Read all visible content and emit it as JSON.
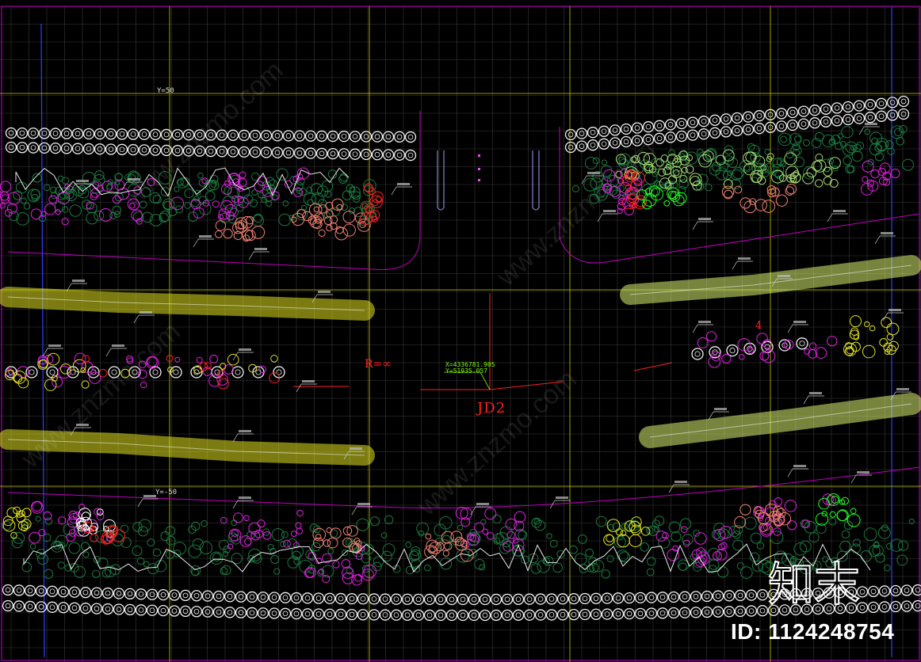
{
  "drawing": {
    "junction_label": "JD2",
    "radius_label": "R=∞",
    "coord_x": "X=4336781.905",
    "coord_y": "Y=51935.057",
    "y_offset_top": "Y=50",
    "y_offset_bottom": "Y=-50",
    "marker_number": "4"
  },
  "watermark": {
    "logo_text": "知末",
    "id_text": "ID: 1124248754",
    "diagonal_text": "www.znzmo.com"
  },
  "colors": {
    "background": "#000000",
    "grid": "#3a3a3a",
    "guide_yellow": "#c8c800",
    "road_magenta": "#c000c0",
    "tree_white": "#f0f0f0",
    "shrub_green": "#1a7a40",
    "flower_magenta": "#e020e0",
    "flower_salmon": "#f08070",
    "hedge_yellow": "#e0e020",
    "label_red": "#ff2020"
  }
}
